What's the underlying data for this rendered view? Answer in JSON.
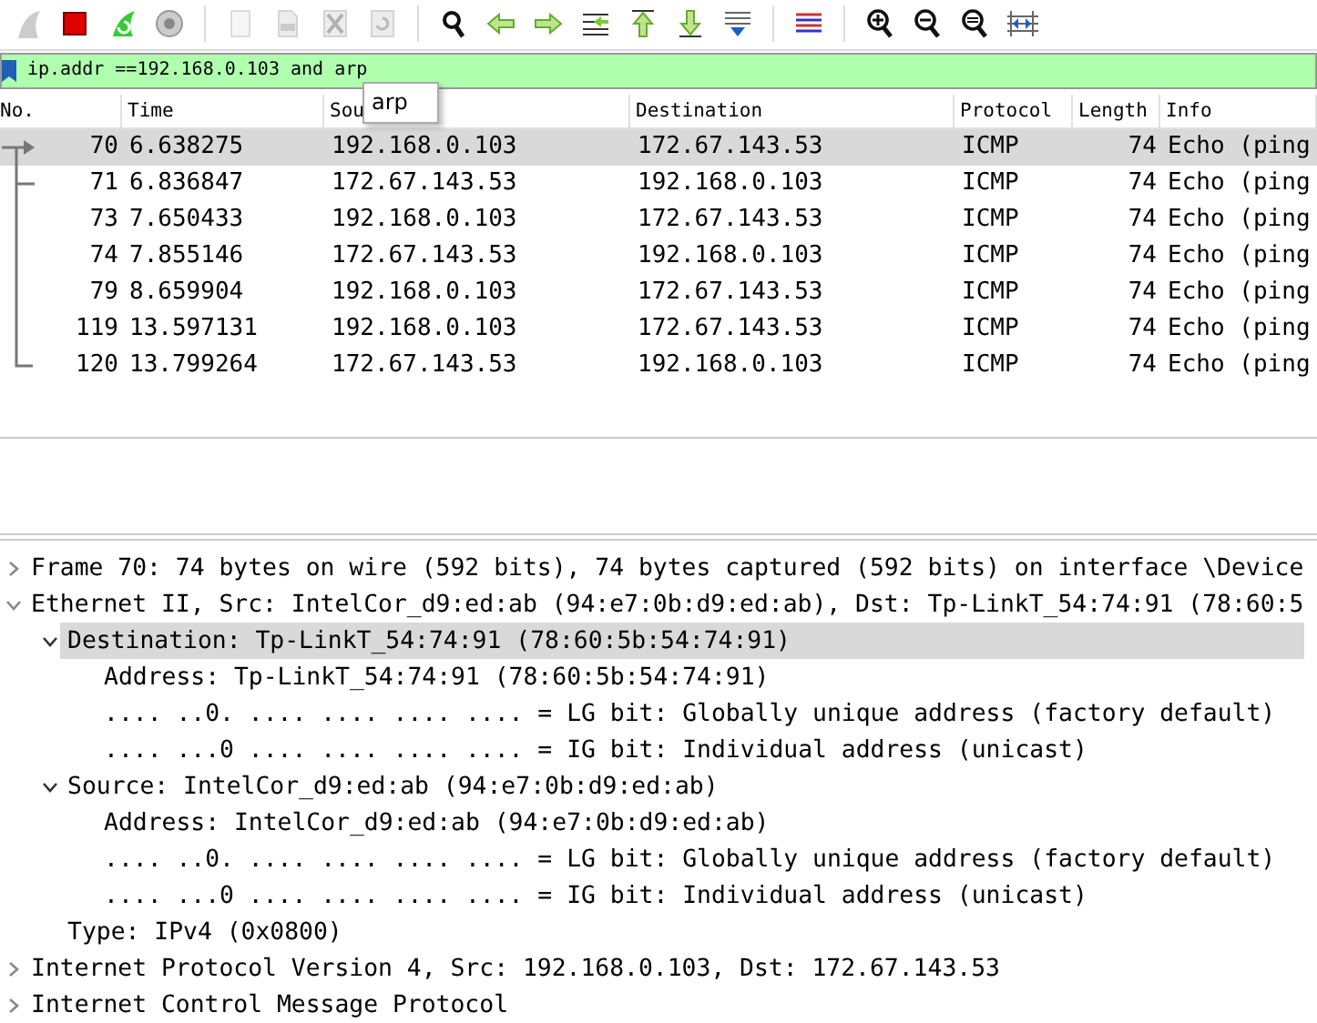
{
  "toolbar_groups": [
    [
      {
        "disabled": true
      },
      {
        "disabled": false
      },
      {
        "disabled": false
      },
      {
        "disabled": false
      }
    ],
    [
      {
        "disabled": true
      },
      {
        "disabled": true
      },
      {
        "disabled": true
      },
      {
        "disabled": true
      }
    ],
    [
      {
        "disabled": false
      },
      {
        "disabled": false
      },
      {
        "disabled": false
      },
      {
        "disabled": false
      },
      {
        "disabled": false
      },
      {
        "disabled": false
      },
      {
        "disabled": false
      }
    ],
    [
      {
        "disabled": false
      }
    ],
    [
      {
        "disabled": false
      },
      {
        "disabled": false
      },
      {
        "disabled": false
      },
      {
        "disabled": false
      }
    ]
  ],
  "filter": {
    "value": "ip.addr ==192.168.0.103 and arp",
    "valid": true,
    "suggestions": [
      "arp"
    ]
  },
  "packet_list": {
    "columns": [
      "No.",
      "Time",
      "Sou",
      "Destination",
      "Protocol",
      "Length",
      "Info"
    ],
    "rows": [
      {
        "no": "70",
        "time": "6.638275",
        "source": "192.168.0.103",
        "destination": "172.67.143.53",
        "protocol": "ICMP",
        "length": "74",
        "info": "Echo (ping",
        "selected": true
      },
      {
        "no": "71",
        "time": "6.836847",
        "source": "172.67.143.53",
        "destination": "192.168.0.103",
        "protocol": "ICMP",
        "length": "74",
        "info": "Echo (ping",
        "selected": false
      },
      {
        "no": "73",
        "time": "7.650433",
        "source": "192.168.0.103",
        "destination": "172.67.143.53",
        "protocol": "ICMP",
        "length": "74",
        "info": "Echo (ping",
        "selected": false
      },
      {
        "no": "74",
        "time": "7.855146",
        "source": "172.67.143.53",
        "destination": "192.168.0.103",
        "protocol": "ICMP",
        "length": "74",
        "info": "Echo (ping",
        "selected": false
      },
      {
        "no": "79",
        "time": "8.659904",
        "source": "192.168.0.103",
        "destination": "172.67.143.53",
        "protocol": "ICMP",
        "length": "74",
        "info": "Echo (ping",
        "selected": false
      },
      {
        "no": "119",
        "time": "13.597131",
        "source": "192.168.0.103",
        "destination": "172.67.143.53",
        "protocol": "ICMP",
        "length": "74",
        "info": "Echo (ping",
        "selected": false
      },
      {
        "no": "120",
        "time": "13.799264",
        "source": "172.67.143.53",
        "destination": "192.168.0.103",
        "protocol": "ICMP",
        "length": "74",
        "info": "Echo (ping",
        "selected": false
      }
    ]
  },
  "details": [
    {
      "text": "Frame 70: 74 bytes on wire (592 bits), 74 bytes captured (592 bits) on interface \\Device",
      "expanded": false,
      "selected": false
    },
    {
      "text": "Ethernet II, Src: IntelCor_d9:ed:ab (94:e7:0b:d9:ed:ab), Dst: Tp-LinkT_54:74:91 (78:60:5",
      "expanded": true,
      "selected": false,
      "children": [
        {
          "text": "Destination: Tp-LinkT_54:74:91 (78:60:5b:54:74:91)",
          "expanded": true,
          "selected": true,
          "children": [
            {
              "text": "Address: Tp-LinkT_54:74:91 (78:60:5b:54:74:91)",
              "selected": false
            },
            {
              "text": ".... ..0. .... .... .... .... = LG bit: Globally unique address (factory default)",
              "selected": false
            },
            {
              "text": ".... ...0 .... .... .... .... = IG bit: Individual address (unicast)",
              "selected": false
            }
          ]
        },
        {
          "text": "Source: IntelCor_d9:ed:ab (94:e7:0b:d9:ed:ab)",
          "expanded": true,
          "selected": false,
          "children": [
            {
              "text": "Address: IntelCor_d9:ed:ab (94:e7:0b:d9:ed:ab)",
              "selected": false
            },
            {
              "text": ".... ..0. .... .... .... .... = LG bit: Globally unique address (factory default)",
              "selected": false
            },
            {
              "text": ".... ...0 .... .... .... .... = IG bit: Individual address (unicast)",
              "selected": false
            }
          ]
        },
        {
          "text": "Type: IPv4 (0x0800)",
          "selected": false
        }
      ]
    },
    {
      "text": "Internet Protocol Version 4, Src: 192.168.0.103, Dst: 172.67.143.53",
      "expanded": false,
      "selected": false
    },
    {
      "text": "Internet Control Message Protocol",
      "expanded": false,
      "selected": false
    }
  ]
}
